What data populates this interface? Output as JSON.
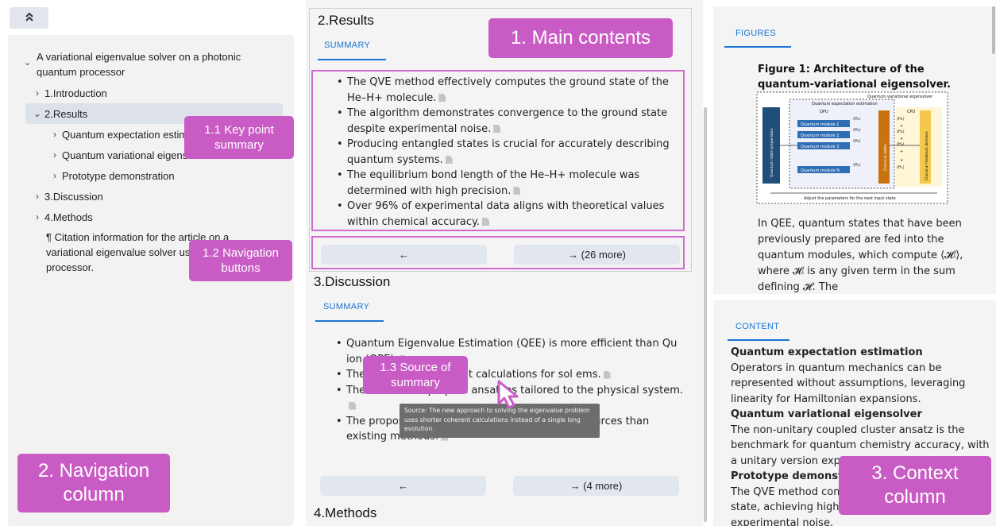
{
  "nav": {
    "collapse_icon": "double-chevron-up",
    "root_title": "A variational eigenvalue solver on a photonic quantum processor",
    "items": [
      {
        "label": "1.Introduction",
        "expanded": false
      },
      {
        "label": "2.Results",
        "expanded": true
      },
      {
        "label": "Quantum expectation estimati",
        "expanded": false
      },
      {
        "label": "Quantum variational eigensolv",
        "expanded": false
      },
      {
        "label": "Prototype demonstration",
        "expanded": false
      },
      {
        "label": "3.Discussion",
        "expanded": false
      },
      {
        "label": "4.Methods",
        "expanded": false
      }
    ],
    "citation": "¶ Citation information for the article on a variational eigenvalue solver us quantum processor."
  },
  "main": {
    "results": {
      "title": "2.Results",
      "tab": "SUMMARY",
      "bullets": [
        "The QVE method effectively computes the ground state of the He–H+ molecule.",
        "The algorithm demonstrates convergence to the ground state despite experimental noise.",
        "Producing entangled states is crucial for accurately describing quantum systems.",
        "The equilibrium bond length of the He–H+ molecule was determined with high precision.",
        "Over 96% of experimental data aligns with theoretical values within chemical accuracy."
      ],
      "prev_label": "←",
      "next_label": "→ (26 more)"
    },
    "discussion": {
      "title": "3.Discussion",
      "tab": "SUMMARY",
      "bullets": [
        "Quantum Eigenvalue Estimation (QEE) is more efficient than Qu ion (QPE).",
        "The for shorter coherent calculations for sol ems.",
        "The device can prepare ansatzes tailored to the physical system.",
        "The propos eme requires significantly fewe resources than existing methods."
      ],
      "prev_label": "←",
      "next_label": "→ (4 more)"
    },
    "methods_title": "4.Methods",
    "tooltip": "Source: The new approach to solving the eigenvalue problem uses shorter coherent calculations instead of a single long evolution."
  },
  "figures": {
    "tab": "FIGURES",
    "caption": "Figure 1: Architecture of the quantum-variational eigensolver.",
    "diagram": {
      "outer_label": "Quantum variational eigensolver",
      "qee_label": "Quantum expectation estimation",
      "qpu_label": "QPU",
      "cpu_label": "CPU",
      "prep_label": "Quantum state preparation",
      "modules": [
        "Quantum module 1",
        "Quantum module 2",
        "Quantum module 3",
        "Quantum module N"
      ],
      "inputs": [
        "⟨H₁⟩",
        "⟨H₂⟩",
        "⟨H₃⟩",
        "⟨Hₙ⟩"
      ],
      "sums": [
        "⟨H₁⟩",
        "+",
        "⟨H₂⟩",
        "+",
        "⟨H₃⟩",
        "+",
        "+",
        "⟨Hₙ⟩"
      ],
      "adder_label": "Classical adder",
      "feedback_label": "Classical feedback decision",
      "bottom_label": "Adjust the parameters for the next input state"
    },
    "text": "In QEE, quantum states that have been previously prepared are fed into the quantum modules, which compute ⟨𝓗ᵢ⟩, where 𝓗ᵢ is any given term in the sum defining 𝓗. The"
  },
  "content": {
    "tab": "CONTENT",
    "paragraphs": [
      {
        "heading": "Quantum expectation estimation",
        "text": "Operators in quantum mechanics can be represented without assumptions, leveraging linearity for Hamiltonian expansions."
      },
      {
        "heading": "Quantum variational eigensolver",
        "text": "The non-unitary coupled cluster ansatz is the benchmark for quantum chemistry accuracy, with a unitary version exp"
      },
      {
        "heading": "Prototype demonst",
        "text": "The QVE method com state, achieving high experimental noise."
      }
    ]
  },
  "annotations": {
    "main_contents": "1. Main contents",
    "key_point": "1.1 Key point summary",
    "nav_buttons": "1.2 Navigation buttons",
    "source": "1.3 Source of summary",
    "nav_column": "2. Navigation column",
    "context_column": "3. Context column"
  },
  "colors": {
    "accent": "#1976d2",
    "callout": "#c95cc4",
    "highlight_border": "#d26bd0",
    "button_bg": "#e1e6ef"
  }
}
